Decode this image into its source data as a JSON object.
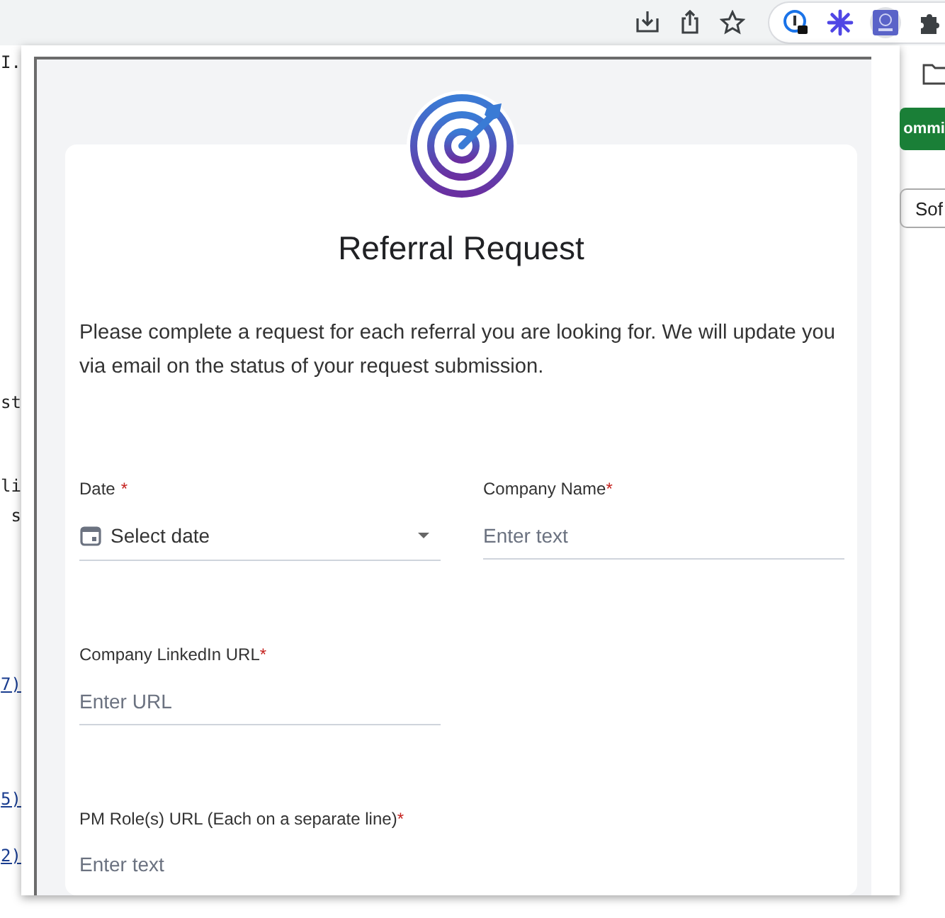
{
  "background_page": {
    "left_fragments": [
      "I.",
      "st",
      "li",
      "s",
      "7)",
      "5)",
      "2)"
    ],
    "commit_button": "ommi",
    "sort_button": "Sof"
  },
  "popup": {
    "title": "Referral Request",
    "intro": "Please complete a request for each referral you are looking for. We will update you via email on the status of your request submission.",
    "fields": [
      {
        "kind": "date",
        "label": "Date",
        "required_mark": "*",
        "placeholder": "Select date"
      },
      {
        "kind": "text",
        "label": "Company Name",
        "required_mark": "*",
        "placeholder": "Enter text"
      },
      {
        "kind": "text",
        "label": "Company LinkedIn URL",
        "required_mark": "*",
        "placeholder": "Enter URL"
      },
      {
        "kind": "textarea",
        "label": "PM Role(s) URL (Each on a separate line)",
        "required_mark": "*",
        "placeholder": "Enter text"
      }
    ]
  }
}
